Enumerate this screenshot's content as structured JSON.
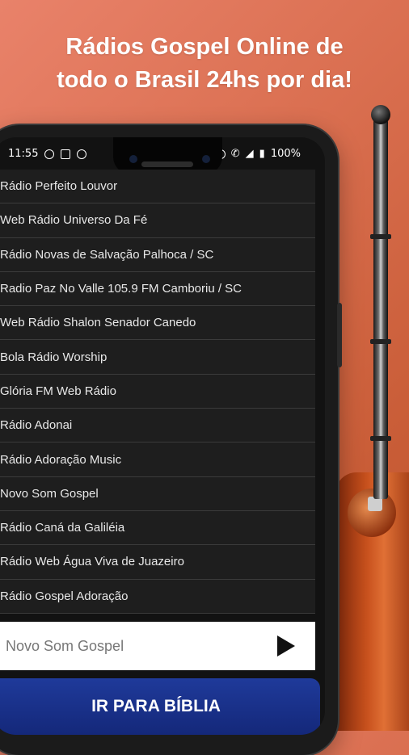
{
  "headline": {
    "line1": "Rádios Gospel Online de",
    "line2": "todo o Brasil 24hs por dia!"
  },
  "status_bar": {
    "time": "11:55",
    "battery": "100%",
    "icons_left": [
      "shield-icon",
      "wallet-icon",
      "at-icon"
    ],
    "icons_right": [
      "dnd-icon",
      "wifi-call-icon",
      "signal-icon",
      "battery-icon"
    ]
  },
  "stations": [
    "Rádio Perfeito Louvor",
    "Web Rádio Universo Da Fé",
    "Rádio Novas de Salvação Palhoca / SC",
    "Radio Paz No Valle 105.9 FM Camboriu / SC",
    "Web Rádio Shalon Senador Canedo",
    "Bola Rádio Worship",
    "Glória FM Web Rádio",
    "Rádio Adonai",
    "Rádio Adoração Music",
    "Novo Som Gospel",
    "Rádio Caná da Galiléia",
    "Rádio Web Água Viva de Juazeiro",
    "Rádio Gospel Adoração"
  ],
  "player": {
    "now_playing": "Novo Som Gospel",
    "play_icon": "play-icon"
  },
  "bible_button": {
    "label": "IR PARA BÍBLIA"
  },
  "colors": {
    "background": "#d96e4f",
    "list_bg": "#1e1e1e",
    "button_bg": "#1f3a9a"
  }
}
